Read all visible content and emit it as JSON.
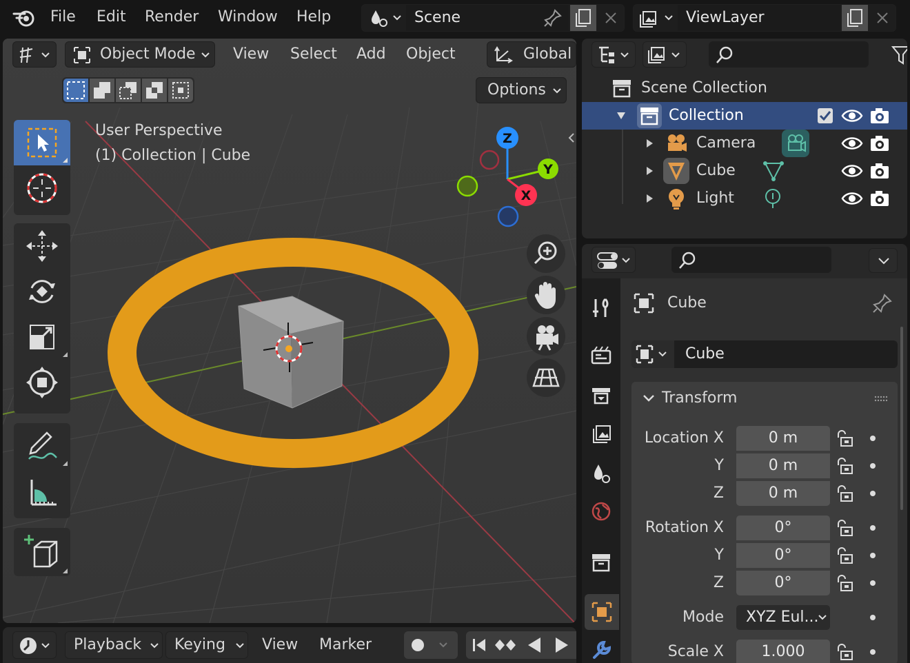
{
  "menu": {
    "items": [
      "File",
      "Edit",
      "Render",
      "Window",
      "Help"
    ]
  },
  "scene": {
    "name": "Scene"
  },
  "view_layer": {
    "name": "ViewLayer"
  },
  "viewport": {
    "mode": "Object Mode",
    "menus": [
      "View",
      "Select",
      "Add",
      "Object"
    ],
    "transform_orientation": "Global",
    "options_label": "Options",
    "perspective_label": "User Perspective",
    "context_label": "(1) Collection | Cube",
    "gizmo_axes": {
      "z": "Z",
      "y": "Y",
      "x": "X"
    }
  },
  "outliner": {
    "root": "Scene Collection",
    "collection": "Collection",
    "items": [
      {
        "label": "Camera",
        "icon": "camera-object-icon"
      },
      {
        "label": "Cube",
        "icon": "mesh-object-icon"
      },
      {
        "label": "Light",
        "icon": "light-object-icon"
      }
    ]
  },
  "properties": {
    "object_name_header": "Cube",
    "object_name_field": "Cube",
    "panel_title": "Transform",
    "location": {
      "label_x": "Location X",
      "label_y": "Y",
      "label_z": "Z",
      "x": "0 m",
      "y": "0 m",
      "z": "0 m"
    },
    "rotation": {
      "label_x": "Rotation X",
      "label_y": "Y",
      "label_z": "Z",
      "x": "0°",
      "y": "0°",
      "z": "0°"
    },
    "mode": {
      "label": "Mode",
      "value": "XYZ Eul..."
    },
    "scale": {
      "label_x": "Scale X",
      "x": "1.000"
    }
  },
  "timeline": {
    "menus": [
      "Playback",
      "Keying",
      "View",
      "Marker"
    ]
  },
  "colors": {
    "accent": "#4772b3",
    "selection_orange": "#f5a623",
    "axis_x": "#ff3352",
    "axis_y": "#8bdc00",
    "axis_z": "#2890ff"
  }
}
